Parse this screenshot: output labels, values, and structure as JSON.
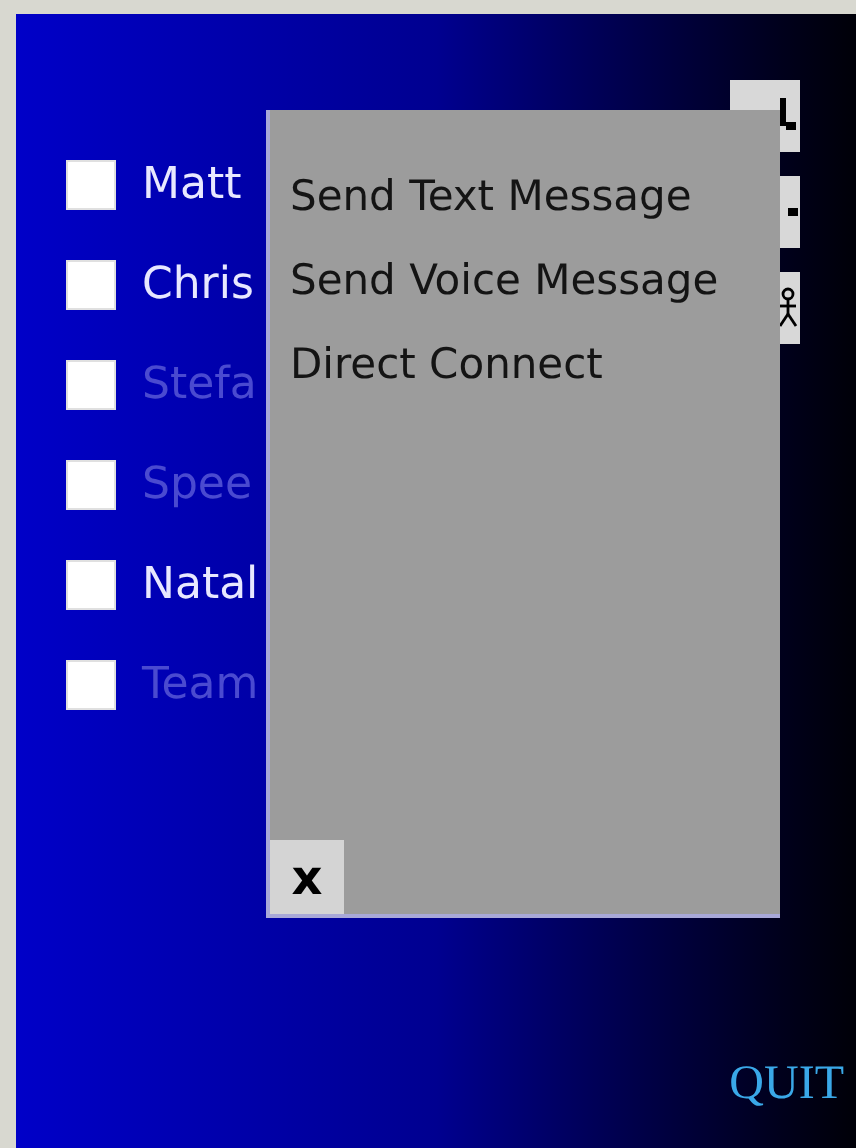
{
  "contacts": [
    {
      "name": "Matt",
      "online": true,
      "checked": false
    },
    {
      "name": "Chris",
      "online": true,
      "checked": false
    },
    {
      "name": "Stefa",
      "online": false,
      "checked": false
    },
    {
      "name": "Spee",
      "online": false,
      "checked": false
    },
    {
      "name": "Natal",
      "online": true,
      "checked": false
    },
    {
      "name": "Team",
      "online": false,
      "checked": false
    }
  ],
  "side_buttons": [
    {
      "kind": "bar"
    },
    {
      "kind": "dot"
    },
    {
      "kind": "figure"
    }
  ],
  "popup_menu": {
    "items": [
      "Send Text Message",
      "Send Voice Message",
      "Direct Connect"
    ],
    "close": "x"
  },
  "quit": "QUIT"
}
